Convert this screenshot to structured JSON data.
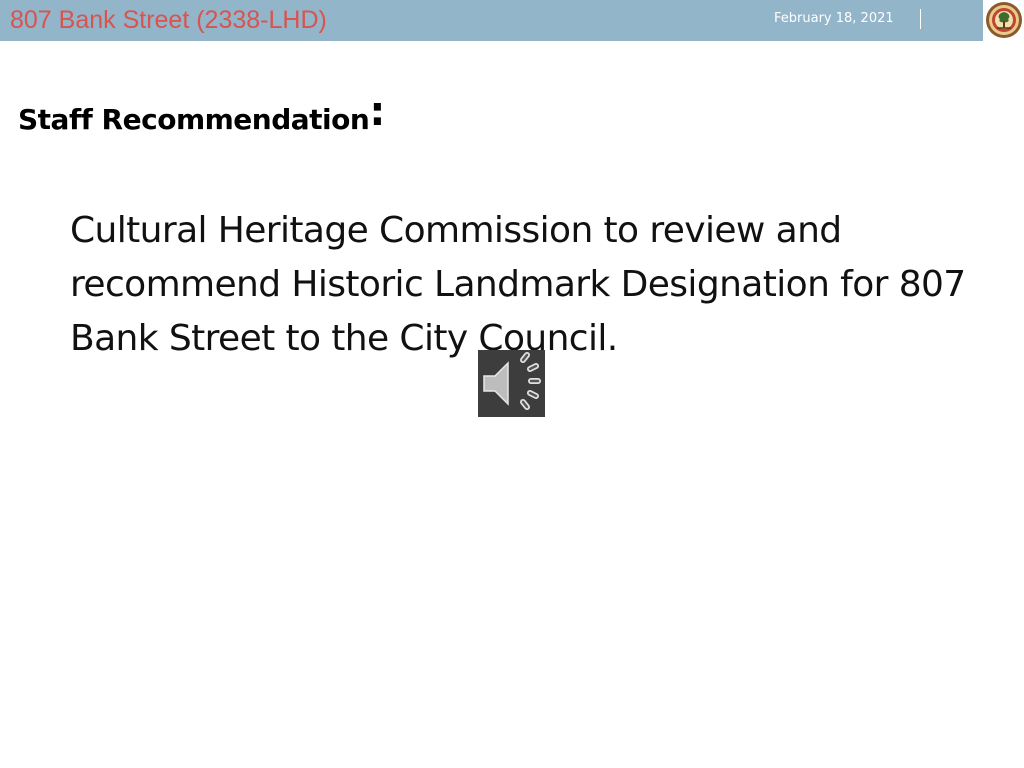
{
  "header": {
    "title": "807 Bank Street (2338-LHD)",
    "date": "February 18, 2021",
    "logo_icon": "city-seal-icon"
  },
  "slide": {
    "heading": "Staff Recommendation",
    "heading_colon": ":",
    "body": "Cultural Heritage Commission to review and recommend Historic Landmark Designation for 807 Bank Street to the City Council."
  },
  "audio": {
    "icon": "speaker-icon"
  },
  "colors": {
    "header_bar": "#93b5ca",
    "title_text": "#d9534f",
    "date_text": "#ffffff",
    "audio_background": "#3d3d3d"
  }
}
